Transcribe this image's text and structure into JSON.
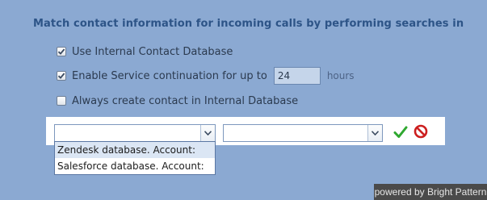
{
  "heading": "Match contact information for incoming calls by performing searches in",
  "options": [
    {
      "label": "Use Internal Contact Database",
      "checked": true
    },
    {
      "label": "Enable Service continuation for up to",
      "checked": true,
      "value": "24",
      "unit": "hours"
    },
    {
      "label": "Always create contact in Internal Database",
      "checked": false
    }
  ],
  "search_row": {
    "source_value": "",
    "account_value": "",
    "dropdown_items": [
      "Zendesk database. Account:",
      "Salesforce database. Account:"
    ]
  },
  "footer": "powered by Bright Pattern",
  "colors": {
    "background": "#8ba9d2",
    "heading": "#2d5487",
    "ok": "#2fa830",
    "cancel": "#cc1f1f"
  },
  "icons": [
    "checkmark-icon",
    "chevron-down-icon",
    "ok-check-icon",
    "cancel-icon"
  ]
}
